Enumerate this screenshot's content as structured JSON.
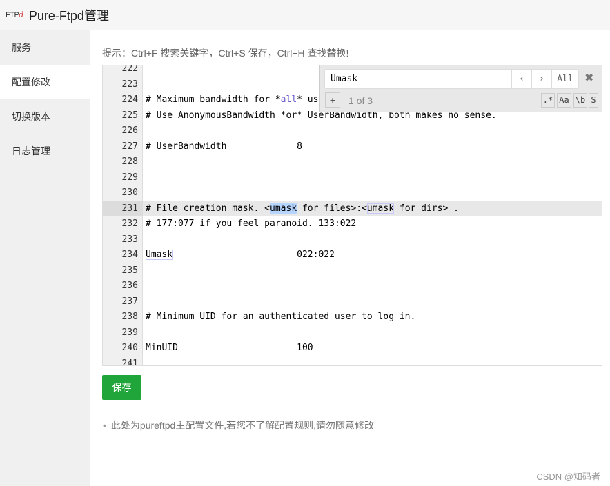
{
  "app": {
    "logo": "FTP",
    "logo_mark": "d",
    "title": "Pure-Ftpd管理"
  },
  "sidebar": {
    "items": [
      {
        "label": "服务"
      },
      {
        "label": "配置修改",
        "active": true
      },
      {
        "label": "切换版本"
      },
      {
        "label": "日志管理"
      }
    ]
  },
  "hint": "提示：Ctrl+F 搜索关键字，Ctrl+S 保存，Ctrl+H 查找替换!",
  "editor": {
    "active_line": 231,
    "lines": [
      {
        "n": "222",
        "seg": []
      },
      {
        "n": "223",
        "seg": []
      },
      {
        "n": "224",
        "seg": [
          [
            "# Maximum bandwidth for *",
            ""
          ],
          [
            "all",
            "kw"
          ],
          [
            "* us",
            ""
          ]
        ]
      },
      {
        "n": "225",
        "seg": [
          [
            "# Use AnonymousBandwidth *or* UserBandwidth, both makes no sense.",
            ""
          ]
        ]
      },
      {
        "n": "226",
        "seg": []
      },
      {
        "n": "227",
        "seg": [
          [
            "# UserBandwidth             8",
            ""
          ]
        ]
      },
      {
        "n": "228",
        "seg": []
      },
      {
        "n": "229",
        "seg": []
      },
      {
        "n": "230",
        "seg": []
      },
      {
        "n": "231",
        "seg": [
          [
            "# File creation mask. <",
            ""
          ],
          [
            "umask",
            "m-cur"
          ],
          [
            " for files>:<",
            ""
          ],
          [
            "umask",
            "m"
          ],
          [
            " for dirs> .",
            ""
          ]
        ]
      },
      {
        "n": "232",
        "seg": [
          [
            "# 177:077 if you feel paranoid. 133:022",
            ""
          ]
        ]
      },
      {
        "n": "233",
        "seg": []
      },
      {
        "n": "234",
        "seg": [
          [
            "Umask",
            "m"
          ],
          [
            "                       022:022",
            ""
          ]
        ]
      },
      {
        "n": "235",
        "seg": []
      },
      {
        "n": "236",
        "seg": []
      },
      {
        "n": "237",
        "seg": []
      },
      {
        "n": "238",
        "seg": [
          [
            "# Minimum UID for an authenticated user to log in.",
            ""
          ]
        ]
      },
      {
        "n": "239",
        "seg": []
      },
      {
        "n": "240",
        "seg": [
          [
            "MinUID                      100",
            ""
          ]
        ]
      },
      {
        "n": "241",
        "seg": []
      }
    ]
  },
  "search": {
    "query": "Umask",
    "prev": "‹",
    "next": "›",
    "all": "All",
    "close": "✖",
    "add": "+",
    "count": "1 of 3",
    "regex": ".*",
    "case": "Aa",
    "word": "\\b",
    "sel": "S"
  },
  "save_label": "保存",
  "note": "此处为pureftpd主配置文件,若您不了解配置规则,请勿随意修改",
  "watermark": "CSDN @知码者",
  "colors": {
    "save": "#20a53a",
    "keyword": "#6a5acd",
    "match_current": "#b5d5ff"
  }
}
